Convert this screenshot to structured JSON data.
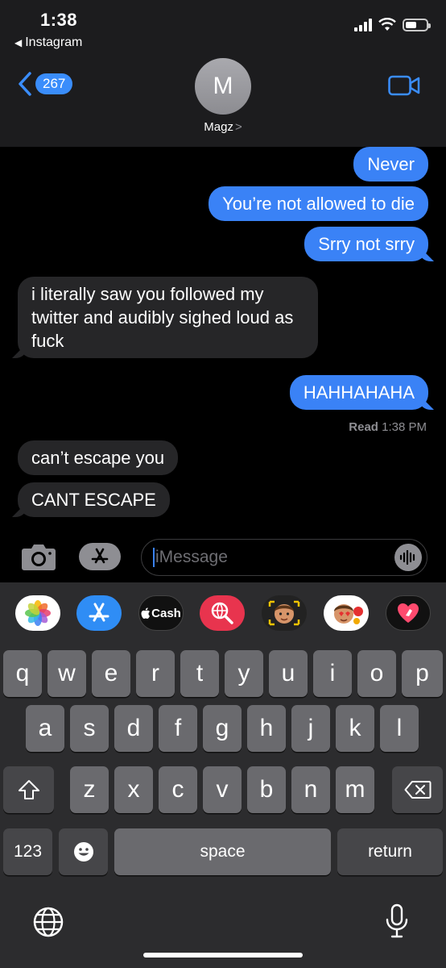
{
  "status_bar": {
    "time": "1:38",
    "back_app": "Instagram"
  },
  "header": {
    "back_count": "267",
    "avatar_initial": "M",
    "contact_name": "Magz",
    "contact_chevron": ">"
  },
  "messages": [
    {
      "from": "me",
      "text": "Never"
    },
    {
      "from": "me",
      "text": "You’re not allowed to die"
    },
    {
      "from": "me",
      "text": "Srry not srry"
    },
    {
      "from": "them",
      "text": "i literally saw you followed my twitter and audibly sighed loud as fuck"
    },
    {
      "from": "me",
      "text": "HAHHAHAHA"
    },
    {
      "from": "them",
      "text": "can’t escape you"
    },
    {
      "from": "them",
      "text": "CANT ESCAPE"
    }
  ],
  "read_receipt": {
    "label": "Read",
    "time": "1:38 PM"
  },
  "input": {
    "placeholder": "iMessage"
  },
  "app_strip": {
    "cash_label": "Cash"
  },
  "keyboard": {
    "row1": [
      "q",
      "w",
      "e",
      "r",
      "t",
      "y",
      "u",
      "i",
      "o",
      "p"
    ],
    "row2": [
      "a",
      "s",
      "d",
      "f",
      "g",
      "h",
      "j",
      "k",
      "l"
    ],
    "row3": [
      "z",
      "x",
      "c",
      "v",
      "b",
      "n",
      "m"
    ],
    "numbers_label": "123",
    "space_label": "space",
    "return_label": "return"
  },
  "colors": {
    "sent_bubble": "#3a82f6",
    "received_bubble": "#262628",
    "accent": "#3a8dfb"
  }
}
